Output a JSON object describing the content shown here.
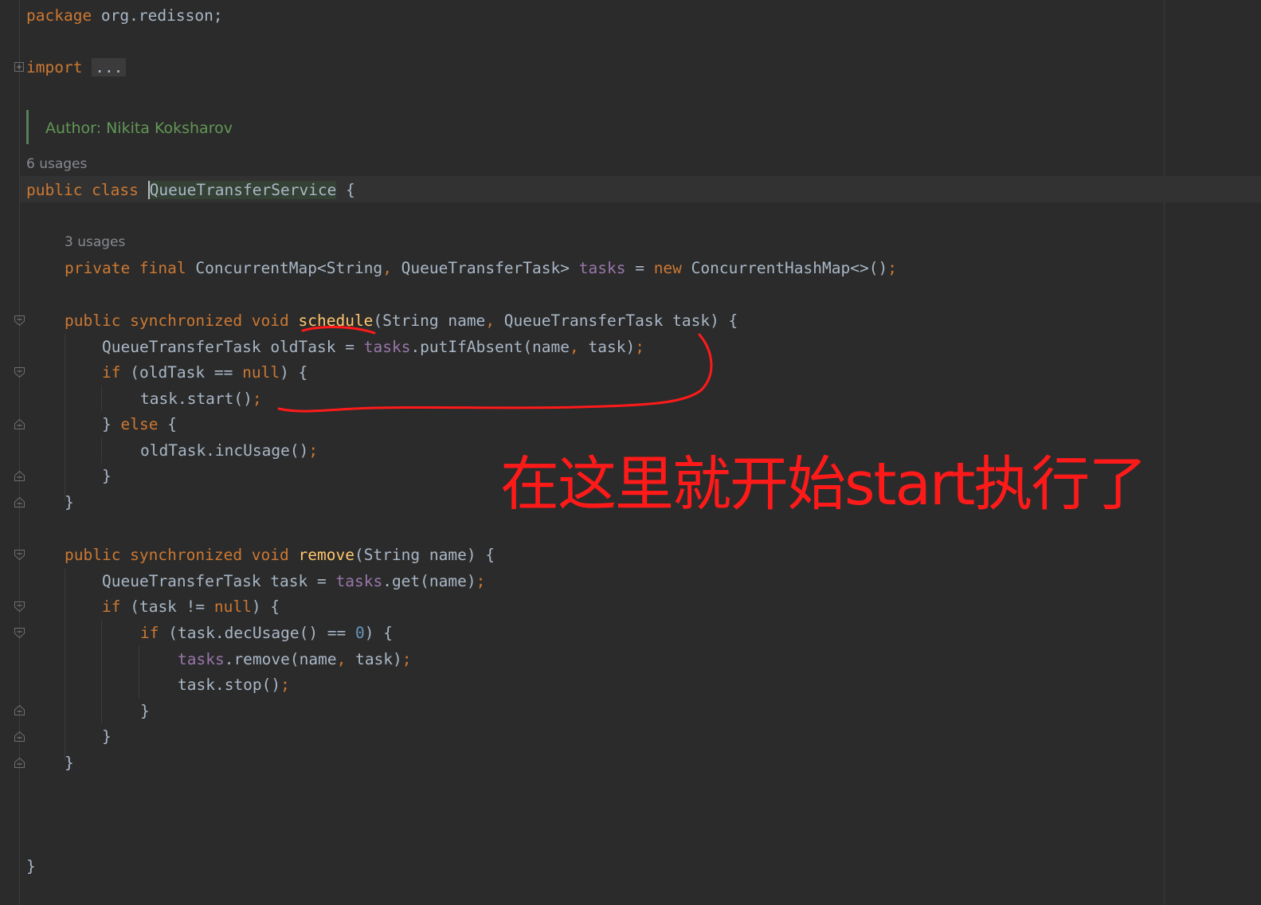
{
  "code": {
    "package_kw": "package",
    "package_name": " org.redisson;",
    "import_kw": "import",
    "import_folded": "...",
    "author_label": "Author: Nikita Koksharov",
    "class_usages": "6 usages",
    "class_mods": "public class ",
    "class_name": "QueueTransferService",
    "class_open": " {",
    "field_usages": "3 usages",
    "field_mods": "private final ",
    "field_type": "ConcurrentMap<String",
    "field_type2": " QueueTransferTask> ",
    "field_name": "tasks",
    "field_assign": " = ",
    "field_new": "new",
    "field_ctor": " ConcurrentHashMap<>()",
    "m1_mods": "public synchronized void ",
    "m1_name": "schedule",
    "m1_params": "(String name",
    "m1_params2": " QueueTransferTask task) {",
    "m1_l1_a": "QueueTransferTask oldTask = ",
    "m1_l1_b": "tasks",
    "m1_l1_c": ".putIfAbsent(name",
    "m1_l1_d": " task)",
    "m1_if": "if",
    "m1_if_a": " (oldTask == ",
    "m1_null": "null",
    "m1_if_b": ") {",
    "m1_start": "task.start()",
    "m1_else_a": "} ",
    "m1_else": "else",
    "m1_else_b": " {",
    "m1_inc": "oldTask.incUsage()",
    "close": "}",
    "m2_mods": "public synchronized void ",
    "m2_name": "remove",
    "m2_params": "(String name) {",
    "m2_l1_a": "QueueTransferTask task = ",
    "m2_l1_b": "tasks",
    "m2_l1_c": ".get(name)",
    "m2_if": "if",
    "m2_if_a": " (task != ",
    "m2_null": "null",
    "m2_if_b": ") {",
    "m2_if2": "if",
    "m2_if2_a": " (task.decUsage() == ",
    "m2_zero": "0",
    "m2_if2_b": ") {",
    "m2_rm_a": "tasks",
    "m2_rm_b": ".remove(name",
    "m2_rm_c": " task)",
    "m2_stop": "task.stop()",
    "semi": ";",
    "comma": ","
  },
  "annotation": {
    "text": "在这里就开始start执行了",
    "color": "#ff1a1a"
  }
}
